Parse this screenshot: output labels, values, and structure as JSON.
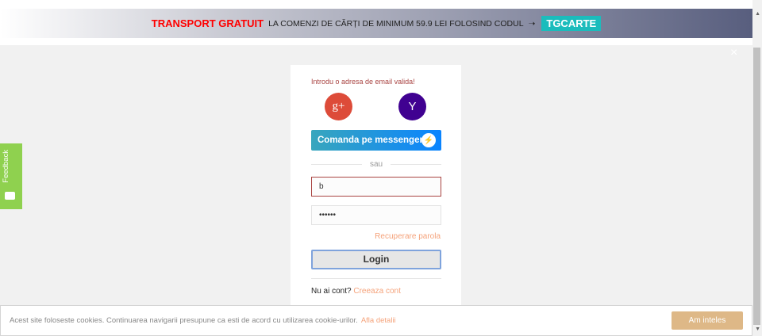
{
  "banner": {
    "highlight": "TRANSPORT GRATUIT",
    "text": "LA COMENZI DE CĂRȚI DE MINIMUM 59.9 LEI FOLOSIND CODUL",
    "arrow": "➝",
    "code": "TGCARTE"
  },
  "close": "×",
  "login": {
    "error": "Introdu o adresa de email valida!",
    "google_label": "g+",
    "yahoo_label": "Y",
    "messenger_label": "Comanda pe messenger",
    "or": "sau",
    "email_value": "b",
    "password_value": "••••••",
    "recover": "Recuperare parola",
    "login_label": "Login",
    "no_account": "Nu ai cont?",
    "create": "Creeaza cont"
  },
  "feedback": "Feedback",
  "cookie": {
    "text": "Acest site foloseste cookies. Continuarea navigarii presupune ca esti de acord cu utilizarea cookie-urilor.",
    "link": "Afla detalii",
    "button": "Am inteles"
  }
}
